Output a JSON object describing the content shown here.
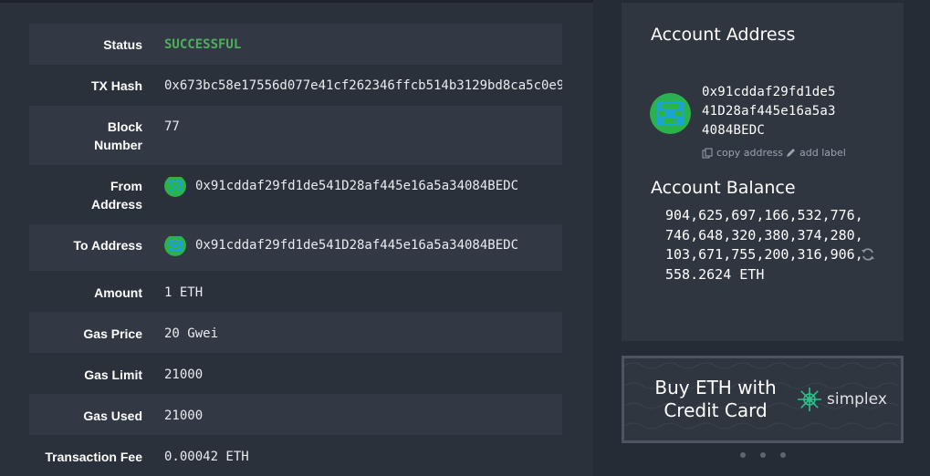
{
  "transaction": {
    "status": {
      "label": "Status",
      "value": "SUCCESSFUL"
    },
    "tx_hash": {
      "label": "TX Hash",
      "value": "0x673bc58e17556d077e41cf262346ffcb514b3129bd8ca5c0e9"
    },
    "block_number": {
      "label": "Block Number",
      "value": "77"
    },
    "from": {
      "label": "From Address",
      "value": "0x91cddaf29fd1de541D28af445e16a5a34084BEDC"
    },
    "to": {
      "label": "To Address",
      "value": "0x91cddaf29fd1de541D28af445e16a5a34084BEDC"
    },
    "amount": {
      "label": "Amount",
      "value": "1 ETH"
    },
    "gas_price": {
      "label": "Gas Price",
      "value": "20 Gwei"
    },
    "gas_limit": {
      "label": "Gas Limit",
      "value": "21000"
    },
    "gas_used": {
      "label": "Gas Used",
      "value": "21000"
    },
    "fee": {
      "label": "Transaction Fee",
      "value": "0.00042 ETH"
    }
  },
  "account": {
    "address_title": "Account Address",
    "address": "0x91cddaf29fd1de541D28af445e16a5a34084BEDC",
    "copy_label": "copy address",
    "add_label": "add label",
    "balance_title": "Account Balance",
    "balance": "904,625,697,166,532,776,746,648,320,380,374,280,103,671,755,200,316,906,558.2624 ETH"
  },
  "banner": {
    "text": "Buy ETH with Credit Card",
    "brand": "simplex"
  },
  "colors": {
    "success": "#4fae5c",
    "identicon_primary": "#1aa4cf",
    "identicon_secondary": "#2bb24c"
  },
  "icons": [
    "identicon",
    "copy-icon",
    "pencil-icon",
    "refresh-icon",
    "simplex-logo-icon"
  ]
}
